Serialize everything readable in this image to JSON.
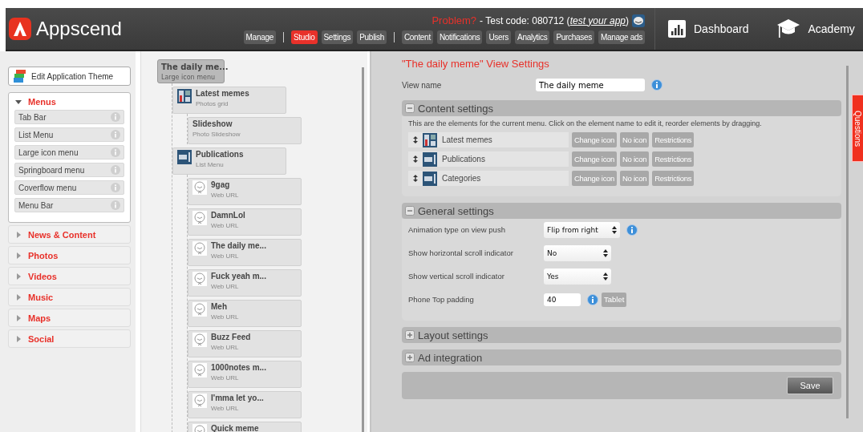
{
  "header": {
    "logo": "Appscend",
    "problem": {
      "label": "Problem?",
      "text": " - Test code: 080712 (",
      "link": "test your app",
      "close": ")"
    },
    "nav_groups": [
      [
        {
          "label": "Manage",
          "selected": false
        }
      ],
      [
        {
          "label": "Studio",
          "selected": true
        },
        {
          "label": "Settings",
          "selected": false
        },
        {
          "label": "Publish",
          "selected": false
        }
      ],
      [
        {
          "label": "Content",
          "selected": false
        },
        {
          "label": "Notifications",
          "selected": false
        },
        {
          "label": "Users",
          "selected": false
        },
        {
          "label": "Analytics",
          "selected": false
        },
        {
          "label": "Purchases",
          "selected": false
        },
        {
          "label": "Manage ads",
          "selected": false
        }
      ]
    ],
    "right_links": [
      {
        "label": "Dashboard",
        "kind": "chart"
      },
      {
        "label": "Academy",
        "kind": "cap"
      }
    ]
  },
  "sidebar": {
    "theme_button": "Edit Application Theme",
    "sections": [
      {
        "title": "Menus",
        "expanded": true,
        "items": [
          "Tab Bar",
          "List Menu",
          "Large icon menu",
          "Springboard menu",
          "Coverflow menu",
          "Menu Bar"
        ]
      },
      {
        "title": "News & Content",
        "expanded": false
      },
      {
        "title": "Photos",
        "expanded": false
      },
      {
        "title": "Videos",
        "expanded": false
      },
      {
        "title": "Music",
        "expanded": false
      },
      {
        "title": "Maps",
        "expanded": false
      },
      {
        "title": "Social",
        "expanded": false
      }
    ]
  },
  "tree": {
    "title": "The daily me...",
    "subtitle": "Large icon menu",
    "selected": true,
    "children": [
      {
        "title": "Latest memes",
        "subtitle": "Photos grid",
        "selected": false,
        "kind": "photos",
        "children": [
          {
            "title": "Slideshow",
            "subtitle": "Photo Slideshow",
            "selected": false
          }
        ]
      },
      {
        "title": "Publications",
        "subtitle": "List Menu",
        "selected": false,
        "kind": "list",
        "children": [
          {
            "title": "9gag",
            "subtitle": "Web URL",
            "selected": false,
            "kind": "web"
          },
          {
            "title": "DamnLol",
            "subtitle": "Web URL",
            "selected": false,
            "kind": "web"
          },
          {
            "title": "The daily me...",
            "subtitle": "Web URL",
            "selected": false,
            "kind": "web"
          },
          {
            "title": "Fuck yeah m...",
            "subtitle": "Web URL",
            "selected": false,
            "kind": "web"
          },
          {
            "title": "Meh",
            "subtitle": "Web URL",
            "selected": false,
            "kind": "web"
          },
          {
            "title": "Buzz Feed",
            "subtitle": "Web URL",
            "selected": false,
            "kind": "web"
          },
          {
            "title": "1000notes m...",
            "subtitle": "Web URL",
            "selected": false,
            "kind": "web"
          },
          {
            "title": "I'mma let yo...",
            "subtitle": "Web URL",
            "selected": false,
            "kind": "web"
          },
          {
            "title": "Quick meme",
            "selected": false,
            "kind": "web"
          }
        ]
      }
    ]
  },
  "settings": {
    "title": "\"The daily meme\" View Settings",
    "view_name": {
      "label": "View name",
      "value": "The daily meme"
    },
    "sections": [
      {
        "title": "Content settings",
        "expanded": true,
        "kind": "elements",
        "description": "This are the elements for the current menu. Click on the element name to edit it, reorder elements by dragging.",
        "elements": [
          {
            "name": "Latest memes",
            "kind": "photos",
            "buttons": [
              "Change icon",
              "No icon",
              "Restrictions"
            ]
          },
          {
            "name": "Publications",
            "kind": "list",
            "buttons": [
              "Change icon",
              "No icon",
              "Restrictions"
            ]
          },
          {
            "name": "Categories",
            "kind": "list",
            "buttons": [
              "Change icon",
              "No icon",
              "Restrictions"
            ]
          }
        ]
      },
      {
        "title": "General settings",
        "expanded": true,
        "kind": "fields",
        "rows": [
          {
            "label": "Animation type on view push",
            "kind": "select",
            "value": "Flip from right",
            "info": true
          },
          {
            "label": "Show horizontal scroll indicator",
            "kind": "select",
            "value": "No",
            "info": false
          },
          {
            "label": "Show vertical scroll indicator",
            "kind": "select",
            "value": "Yes",
            "info": false
          },
          {
            "label": "Phone Top padding",
            "kind": "input",
            "value": "40",
            "info": true,
            "button": "Tablet"
          }
        ]
      },
      {
        "title": "Layout settings",
        "expanded": false
      },
      {
        "title": "Ad integration",
        "expanded": false
      }
    ],
    "save": "Save"
  },
  "questions_tab": "Questions"
}
